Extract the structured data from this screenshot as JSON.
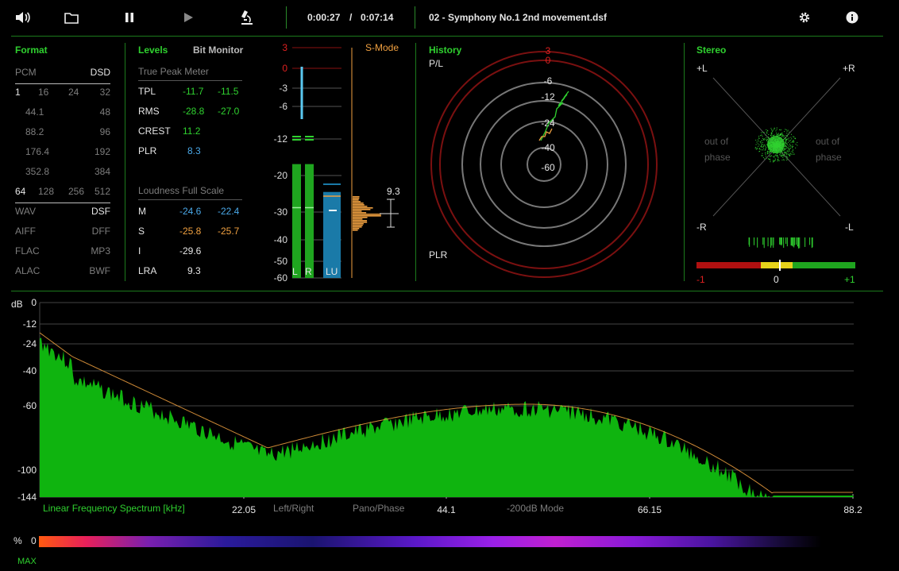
{
  "toolbar": {
    "time_current": "0:00:27",
    "time_sep": "/",
    "time_total": "0:07:14",
    "track_title": "02 - Symphony No.1 2nd movement.dsf"
  },
  "format": {
    "title": "Format",
    "rows": [
      [
        "PCM",
        "",
        "",
        "DSD"
      ],
      [
        "1",
        "16",
        "24",
        "32"
      ],
      [
        "44.1",
        "",
        "",
        "48"
      ],
      [
        "88.2",
        "",
        "",
        "96"
      ],
      [
        "176.4",
        "",
        "",
        "192"
      ],
      [
        "352.8",
        "",
        "",
        "384"
      ],
      [
        "64",
        "128",
        "256",
        "512"
      ],
      [
        "WAV",
        "",
        "",
        "DSF"
      ],
      [
        "AIFF",
        "",
        "",
        "DFF"
      ],
      [
        "FLAC",
        "",
        "",
        "MP3"
      ],
      [
        "ALAC",
        "",
        "",
        "BWF"
      ]
    ]
  },
  "levels": {
    "title": "Levels",
    "bit_monitor": "Bit Monitor",
    "true_peak_title": "True Peak Meter",
    "tpl_label": "TPL",
    "tpl_l": "-11.7",
    "tpl_r": "-11.5",
    "rms_label": "RMS",
    "rms_l": "-28.8",
    "rms_r": "-27.0",
    "crest_label": "CREST",
    "crest_val": "11.2",
    "plr_label": "PLR",
    "plr_val": "8.3",
    "loudness_title": "Loudness Full Scale",
    "m_label": "M",
    "m_val": "-24.6",
    "m_max": "-22.4",
    "s_label": "S",
    "s_val": "-25.8",
    "s_max": "-25.7",
    "i_label": "I",
    "i_val": "-29.6",
    "lra_label": "LRA",
    "lra_val": "9.3"
  },
  "meter": {
    "scale": [
      "3",
      "0",
      "-3",
      "-6",
      "-12",
      "-20",
      "-30",
      "-40",
      "-50",
      "-60"
    ],
    "label_l": "L",
    "label_r": "R",
    "label_lu": "LU",
    "smode": "S-Mode",
    "hist_value": "9.3",
    "peak_l_db": -6.5,
    "peak_r_db": -6.5,
    "level_l_db": -17.5,
    "level_r_db": -17.5,
    "level_lu_db": -24.5
  },
  "history": {
    "title": "History",
    "pl": "P/L",
    "plr": "PLR",
    "rings": [
      "3",
      "0",
      "-6",
      "-12",
      "-24",
      "-40",
      "-60"
    ]
  },
  "stereo": {
    "title": "Stereo",
    "plus_l": "+L",
    "plus_r": "+R",
    "minus_r": "-R",
    "minus_l": "-L",
    "oop_left": "out of\nphase",
    "oop_right": "out of\nphase",
    "corr_min": "-1",
    "corr_mid": "0",
    "corr_max": "+1",
    "correlation": 0.05
  },
  "spectrum": {
    "db_label": "dB",
    "y_ticks": [
      "0",
      "-12",
      "-24",
      "-40",
      "-60",
      "-100",
      "-144"
    ],
    "x_ticks": [
      "22.05",
      "44.1",
      "66.15",
      "88.2"
    ],
    "title": "Linear Frequency Spectrum [kHz]",
    "left_right": "Left/Right",
    "pano_phase": "Pano/Phase",
    "mode": "-200dB Mode"
  },
  "bitbar": {
    "pct": "%",
    "zero": "0",
    "max": "MAX"
  },
  "colors": {
    "accent": "#2fd12f",
    "blue": "#4aa8e8",
    "orange": "#f0a040",
    "red": "#e02020"
  }
}
